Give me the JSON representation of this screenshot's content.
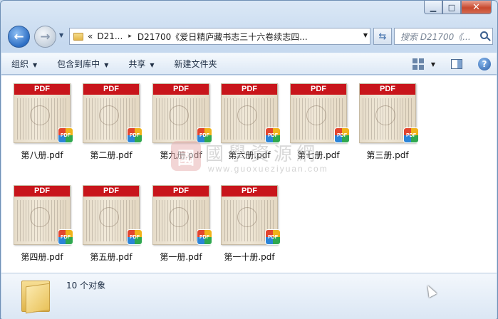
{
  "window": {
    "caption_buttons": [
      "minimize",
      "maximize",
      "close"
    ]
  },
  "nav": {
    "back_icon": "arrow-left",
    "forward_icon": "arrow-right",
    "address": {
      "overflow": "«",
      "segments": [
        "D21...",
        "D21700《爱日精庐藏书志三十六卷续志四..."
      ],
      "separator": "▸"
    },
    "search_placeholder": "搜索 D21700《..."
  },
  "toolbar": {
    "organize": "组织",
    "include_library": "包含到库中",
    "share": "共享",
    "new_folder": "新建文件夹"
  },
  "files": [
    {
      "name": "第八册.pdf",
      "thumb_label": "PDF"
    },
    {
      "name": "第二册.pdf",
      "thumb_label": "PDF"
    },
    {
      "name": "第九册.pdf",
      "thumb_label": "PDF"
    },
    {
      "name": "第六册.pdf",
      "thumb_label": "PDF"
    },
    {
      "name": "第七册.pdf",
      "thumb_label": "PDF"
    },
    {
      "name": "第三册.pdf",
      "thumb_label": "PDF"
    },
    {
      "name": "第四册.pdf",
      "thumb_label": "PDF"
    },
    {
      "name": "第五册.pdf",
      "thumb_label": "PDF"
    },
    {
      "name": "第一册.pdf",
      "thumb_label": "PDF"
    },
    {
      "name": "第一十册.pdf",
      "thumb_label": "PDF"
    }
  ],
  "badge_label": "PDF",
  "watermark": {
    "seal": "國",
    "title": "國學資源網",
    "url": "www.guoxueziyuan.com"
  },
  "status": {
    "count": "10 个对象"
  },
  "colors": {
    "pdf_red": "#c8151b",
    "chrome_blue": "#c6d9ef"
  }
}
